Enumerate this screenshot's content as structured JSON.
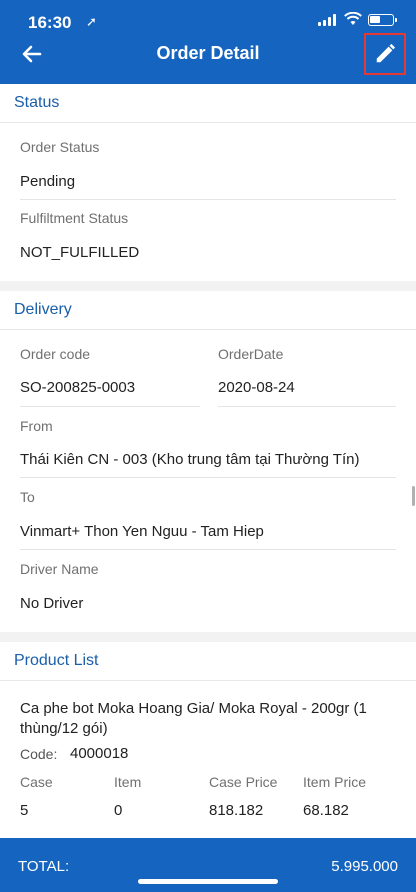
{
  "status_bar": {
    "time": "16:30",
    "location_icon": "location-arrow-icon"
  },
  "header": {
    "title": "Order Detail",
    "back_icon": "arrow-left-icon",
    "edit_icon": "pencil-icon"
  },
  "status_section": {
    "title": "Status",
    "order_status_label": "Order Status",
    "order_status_value": "Pending",
    "fulfillment_label": "Fulfiltment Status",
    "fulfillment_value": "NOT_FULFILLED"
  },
  "delivery_section": {
    "title": "Delivery",
    "order_code_label": "Order code",
    "order_code_value": "SO-200825-0003",
    "order_date_label": "OrderDate",
    "order_date_value": "2020-08-24",
    "from_label": "From",
    "from_value": "Thái Kiên CN - 003  (Kho trung tâm tại Thường Tín)",
    "to_label": "To",
    "to_value": "Vinmart+ Thon Yen Nguu - Tam Hiep",
    "driver_label": "Driver Name",
    "driver_value": "No Driver"
  },
  "product_section": {
    "title": "Product List",
    "product_name_line1": "Ca phe bot Moka Hoang Gia/ Moka Royal - 200gr (1",
    "product_name_line2": "thùng/12 gói)",
    "code_label": "Code:",
    "code_value": "4000018",
    "columns": [
      "Case",
      "Item",
      "Case Price",
      "Item Price"
    ],
    "values": [
      "5",
      "0",
      "818.182",
      "68.182"
    ]
  },
  "footer": {
    "total_label": "TOTAL:",
    "total_value": "5.995.000"
  },
  "colors": {
    "primary": "#1565c0",
    "section_title": "#1a5fa8",
    "highlight": "#e53935"
  }
}
